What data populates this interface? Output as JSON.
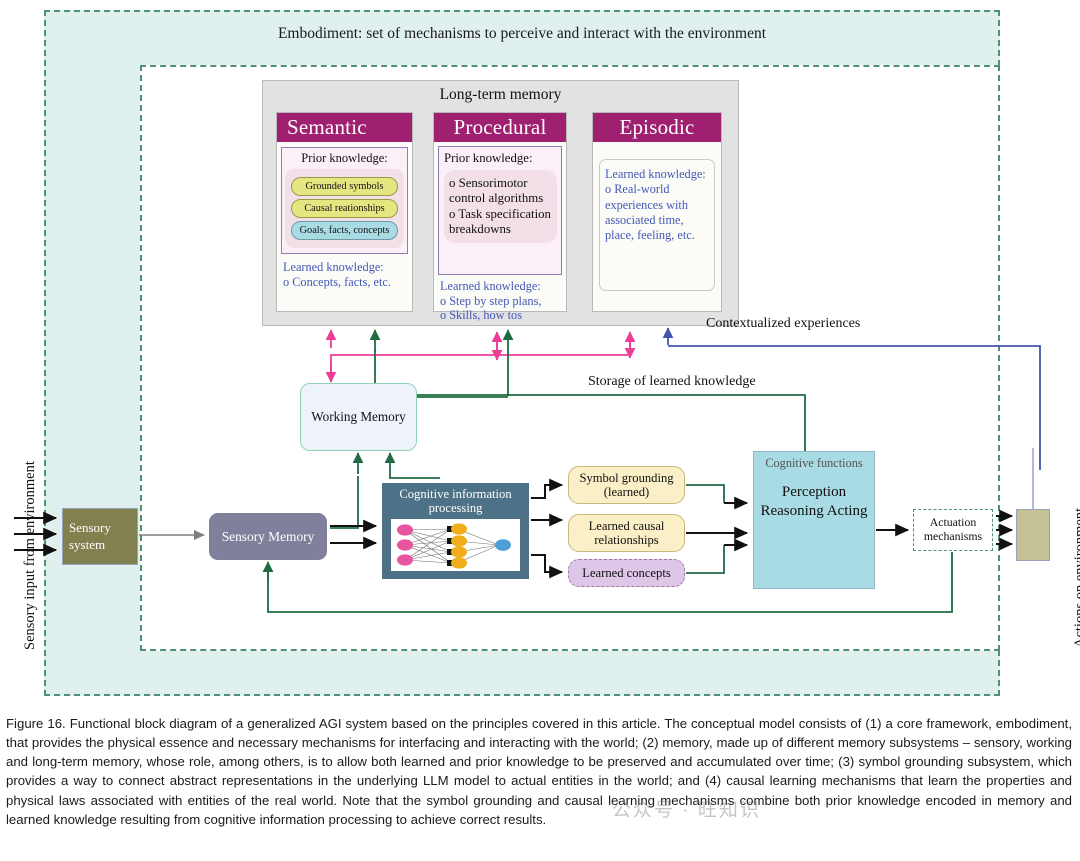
{
  "figure": {
    "embodiment_label": "Embodiment: set of mechanisms to perceive and interact with the environment",
    "sensory_input_label": "Sensory input from  environment",
    "actions_label": "Actions on environment",
    "contextualized_label": "Contextualized experiences",
    "storage_label": "Storage of learned knowledge"
  },
  "long_term_memory": {
    "title": "Long-term memory",
    "columns": [
      {
        "name": "Semantic",
        "prior_title": "Prior knowledge:",
        "pills": [
          "Grounded symbols",
          "Causal reationships",
          "Goals, facts, concepts"
        ],
        "learned_title": "Learned knowledge:",
        "learned_items": [
          "o Concepts, facts, etc."
        ]
      },
      {
        "name": "Procedural",
        "prior_title": "Prior knowledge:",
        "prior_items": [
          "o Sensorimotor",
          "   control algorithms",
          "o Task specification",
          "   breakdowns"
        ],
        "learned_title": "Learned knowledge:",
        "learned_items": [
          "o Step by step plans,",
          "o Skills, how tos"
        ]
      },
      {
        "name": "Episodic",
        "learned_title": "Learned knowledge:",
        "learned_items": [
          "o Real-world",
          "   experiences with",
          "   associated time,",
          "   place, feeling, etc."
        ]
      }
    ]
  },
  "blocks": {
    "working_memory": "Working Memory",
    "sensory_system": "Sensory system",
    "sensory_memory": "Sensory Memory",
    "cognitive_information_processing": "Cognitive information processing",
    "symbol_grounding": "Symbol grounding (learned)",
    "learned_causal": "Learned causal relationships",
    "learned_concepts": "Learned concepts",
    "cognitive_functions_title": "Cognitive functions",
    "cognitive_functions_body": "Perception Reasoning Acting",
    "actuation_mechanisms": "Actuation mechanisms"
  },
  "caption": "Figure 16. Functional block diagram of a generalized AGI system based on the principles covered in this article. The conceptual model consists of (1) a core framework, embodiment, that provides the physical essence and necessary mechanisms for interfacing and interacting with the world; (2) memory, made up of different memory subsystems – sensory, working and long-term memory, whose role, among others, is to allow both learned and prior knowledge to be preserved and accumulated over time; (3) symbol grounding subsystem, which provides a way to connect abstract representations in the underlying LLM model to actual entities in the world; and (4) causal learning mechanisms that learn the properties and physical laws associated with entities of the real world. Note that the symbol grounding and causal learning mechanisms combine both prior knowledge encoded in memory and learned knowledge resulting from cognitive information processing to achieve correct results.",
  "watermark": "公众号 · 旺知识",
  "colors": {
    "embodiment_fill": "#dff0ef",
    "frame_dashed": "#4f9177",
    "memory_header": "#9f2070",
    "learned_text": "#4458b8",
    "pink_arrow": "#ee3d96",
    "green_arrow": "#1f6b41",
    "blue_arrow": "#4455b0",
    "cip_fill": "#4d7186",
    "cognitive_functions_fill": "#a8dbe4"
  },
  "neural_net": {
    "input_nodes": 3,
    "hidden_nodes": 4,
    "output_nodes": 1,
    "input_color": "#e8559f",
    "hidden_color": "#f0ae1c",
    "output_color": "#4d9fd6"
  }
}
